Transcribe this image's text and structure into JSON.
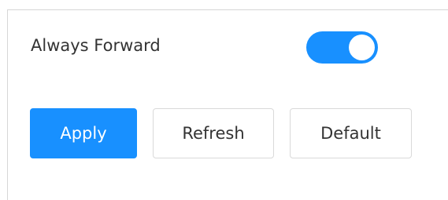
{
  "settings": {
    "always_forward": {
      "label": "Always Forward",
      "enabled": true
    }
  },
  "actions": {
    "apply_label": "Apply",
    "refresh_label": "Refresh",
    "default_label": "Default"
  },
  "colors": {
    "accent": "#1890ff",
    "text": "#333333",
    "border": "#d9d9d9"
  }
}
